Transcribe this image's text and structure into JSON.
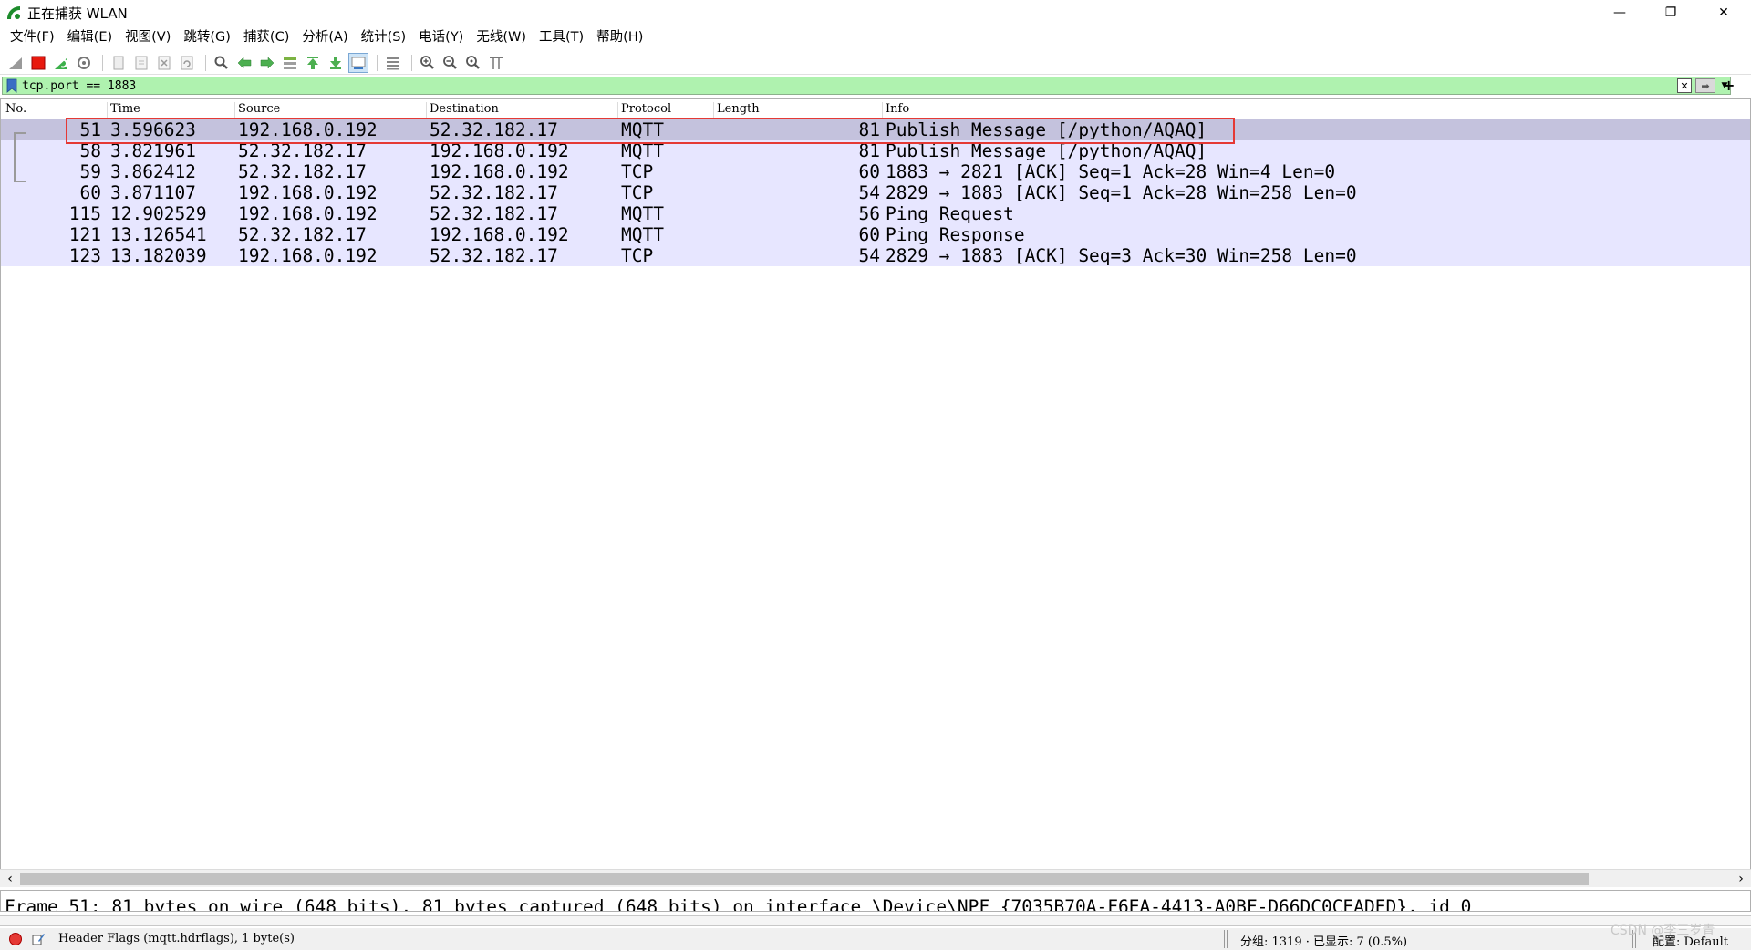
{
  "window": {
    "title": "正在捕获 WLAN",
    "minimize": "—",
    "restore": "❐",
    "close": "✕"
  },
  "menu": [
    "文件(F)",
    "编辑(E)",
    "视图(V)",
    "跳转(G)",
    "捕获(C)",
    "分析(A)",
    "统计(S)",
    "电话(Y)",
    "无线(W)",
    "工具(T)",
    "帮助(H)"
  ],
  "toolbar_icons": [
    "shark-fin-start-icon",
    "stop-capture-icon",
    "restart-capture-icon",
    "capture-options-icon",
    "open-file-icon",
    "save-file-icon",
    "close-file-icon",
    "reload-file-icon",
    "find-packet-icon",
    "go-back-icon",
    "go-forward-icon",
    "go-to-packet-icon",
    "first-packet-icon",
    "last-packet-icon",
    "autoscroll-icon",
    "colorize-icon",
    "zoom-in-icon",
    "zoom-out-icon",
    "zoom-normal-icon",
    "resize-columns-icon"
  ],
  "filter": {
    "value": "tcp.port == 1883",
    "add": "+"
  },
  "columns": {
    "no": "No.",
    "time": "Time",
    "source": "Source",
    "destination": "Destination",
    "protocol": "Protocol",
    "length": "Length",
    "info": "Info"
  },
  "packets": [
    {
      "no": "51",
      "time": "3.596623",
      "source": "192.168.0.192",
      "destination": "52.32.182.17",
      "protocol": "MQTT",
      "length": "81",
      "info": "Publish Message [/python/AQAQ]"
    },
    {
      "no": "58",
      "time": "3.821961",
      "source": "52.32.182.17",
      "destination": "192.168.0.192",
      "protocol": "MQTT",
      "length": "81",
      "info": "Publish Message [/python/AQAQ]"
    },
    {
      "no": "59",
      "time": "3.862412",
      "source": "52.32.182.17",
      "destination": "192.168.0.192",
      "protocol": "TCP",
      "length": "60",
      "info": "1883 → 2821 [ACK] Seq=1 Ack=28 Win=4 Len=0"
    },
    {
      "no": "60",
      "time": "3.871107",
      "source": "192.168.0.192",
      "destination": "52.32.182.17",
      "protocol": "TCP",
      "length": "54",
      "info": "2829 → 1883 [ACK] Seq=1 Ack=28 Win=258 Len=0"
    },
    {
      "no": "115",
      "time": "12.902529",
      "source": "192.168.0.192",
      "destination": "52.32.182.17",
      "protocol": "MQTT",
      "length": "56",
      "info": "Ping Request"
    },
    {
      "no": "121",
      "time": "13.126541",
      "source": "52.32.182.17",
      "destination": "192.168.0.192",
      "protocol": "MQTT",
      "length": "60",
      "info": "Ping Response"
    },
    {
      "no": "123",
      "time": "13.182039",
      "source": "192.168.0.192",
      "destination": "52.32.182.17",
      "protocol": "TCP",
      "length": "54",
      "info": "2829 → 1883 [ACK] Seq=3 Ack=30 Win=258 Len=0"
    }
  ],
  "selected_index": 0,
  "details": {
    "frame_line": "Frame 51: 81 bytes on wire (648 bits), 81 bytes captured (648 bits) on interface \\Device\\NPF_{7035B70A-F6EA-4413-A0BF-D66DC0CEADED}, id 0"
  },
  "status": {
    "field": "Header Flags (mqtt.hdrflags), 1 byte(s)",
    "stats": "分组: 1319 · 已显示: 7 (0.5%)",
    "profile": "配置: Default",
    "watermark": "CSDN @李三岁青"
  },
  "colors": {
    "row_bg": "#e7e6ff",
    "selected_row_bg": "#c4c2dd",
    "filter_ok_bg": "#aff2af",
    "highlight_box": "#e53935"
  }
}
